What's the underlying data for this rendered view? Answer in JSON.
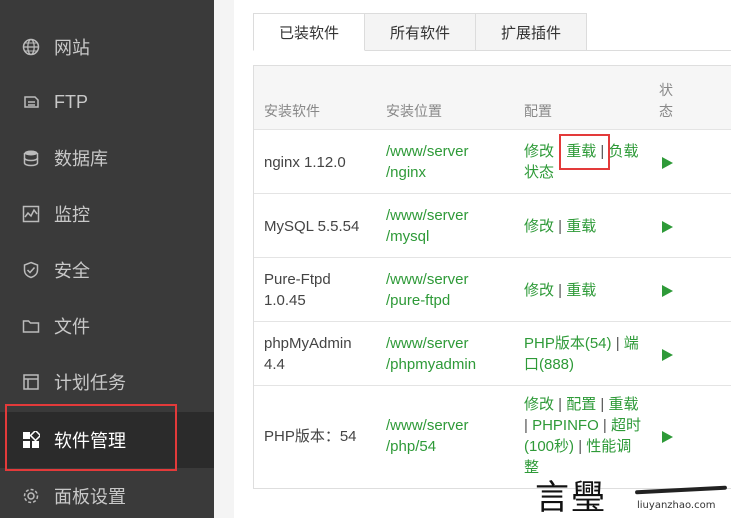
{
  "sidebar": {
    "items": [
      {
        "label": "网站",
        "icon": "globe-icon"
      },
      {
        "label": "FTP",
        "icon": "ftp-icon"
      },
      {
        "label": "数据库",
        "icon": "database-icon"
      },
      {
        "label": "监控",
        "icon": "monitor-icon"
      },
      {
        "label": "安全",
        "icon": "shield-icon"
      },
      {
        "label": "文件",
        "icon": "folder-icon"
      },
      {
        "label": "计划任务",
        "icon": "task-icon"
      },
      {
        "label": "软件管理",
        "icon": "apps-icon"
      },
      {
        "label": "面板设置",
        "icon": "gear-icon"
      }
    ],
    "active": "软件管理",
    "highlight_color": "#e33a3a"
  },
  "tabs": [
    "已装软件",
    "所有软件",
    "扩展插件"
  ],
  "table": {
    "headers": {
      "name": "安装软件",
      "path": "安装位置",
      "config": "配置",
      "status_line1": "状",
      "status_line2": "态"
    },
    "rows": [
      {
        "name": [
          "nginx 1.12.0"
        ],
        "path": [
          "/www/server",
          "/nginx"
        ],
        "config": [
          "修改",
          "重载",
          "负载状态"
        ]
      },
      {
        "name": [
          "MySQL 5.5.54"
        ],
        "path": [
          "/www/server",
          "/mysql"
        ],
        "config": [
          "修改",
          "重载"
        ]
      },
      {
        "name": [
          "Pure-Ftpd",
          "1.0.45"
        ],
        "path": [
          "/www/server",
          "/pure-ftpd"
        ],
        "config": [
          "修改",
          "重载"
        ]
      },
      {
        "name": [
          "phpMyAdmin",
          "4.4"
        ],
        "path": [
          "/www/server",
          "/phpmyadmin"
        ],
        "config": [
          "PHP版本(54)",
          "端口(888)"
        ]
      },
      {
        "name": [
          "PHP版本：54"
        ],
        "path": [
          "/www/server",
          "/php/54"
        ],
        "config": [
          "修改",
          "配置",
          "重载",
          "PHPINFO",
          "超时(100秒)",
          "性能调整"
        ]
      }
    ],
    "link_color": "#2e9a38"
  },
  "watermark": {
    "logo": "言璺",
    "url": "liuyanzhao.com"
  }
}
